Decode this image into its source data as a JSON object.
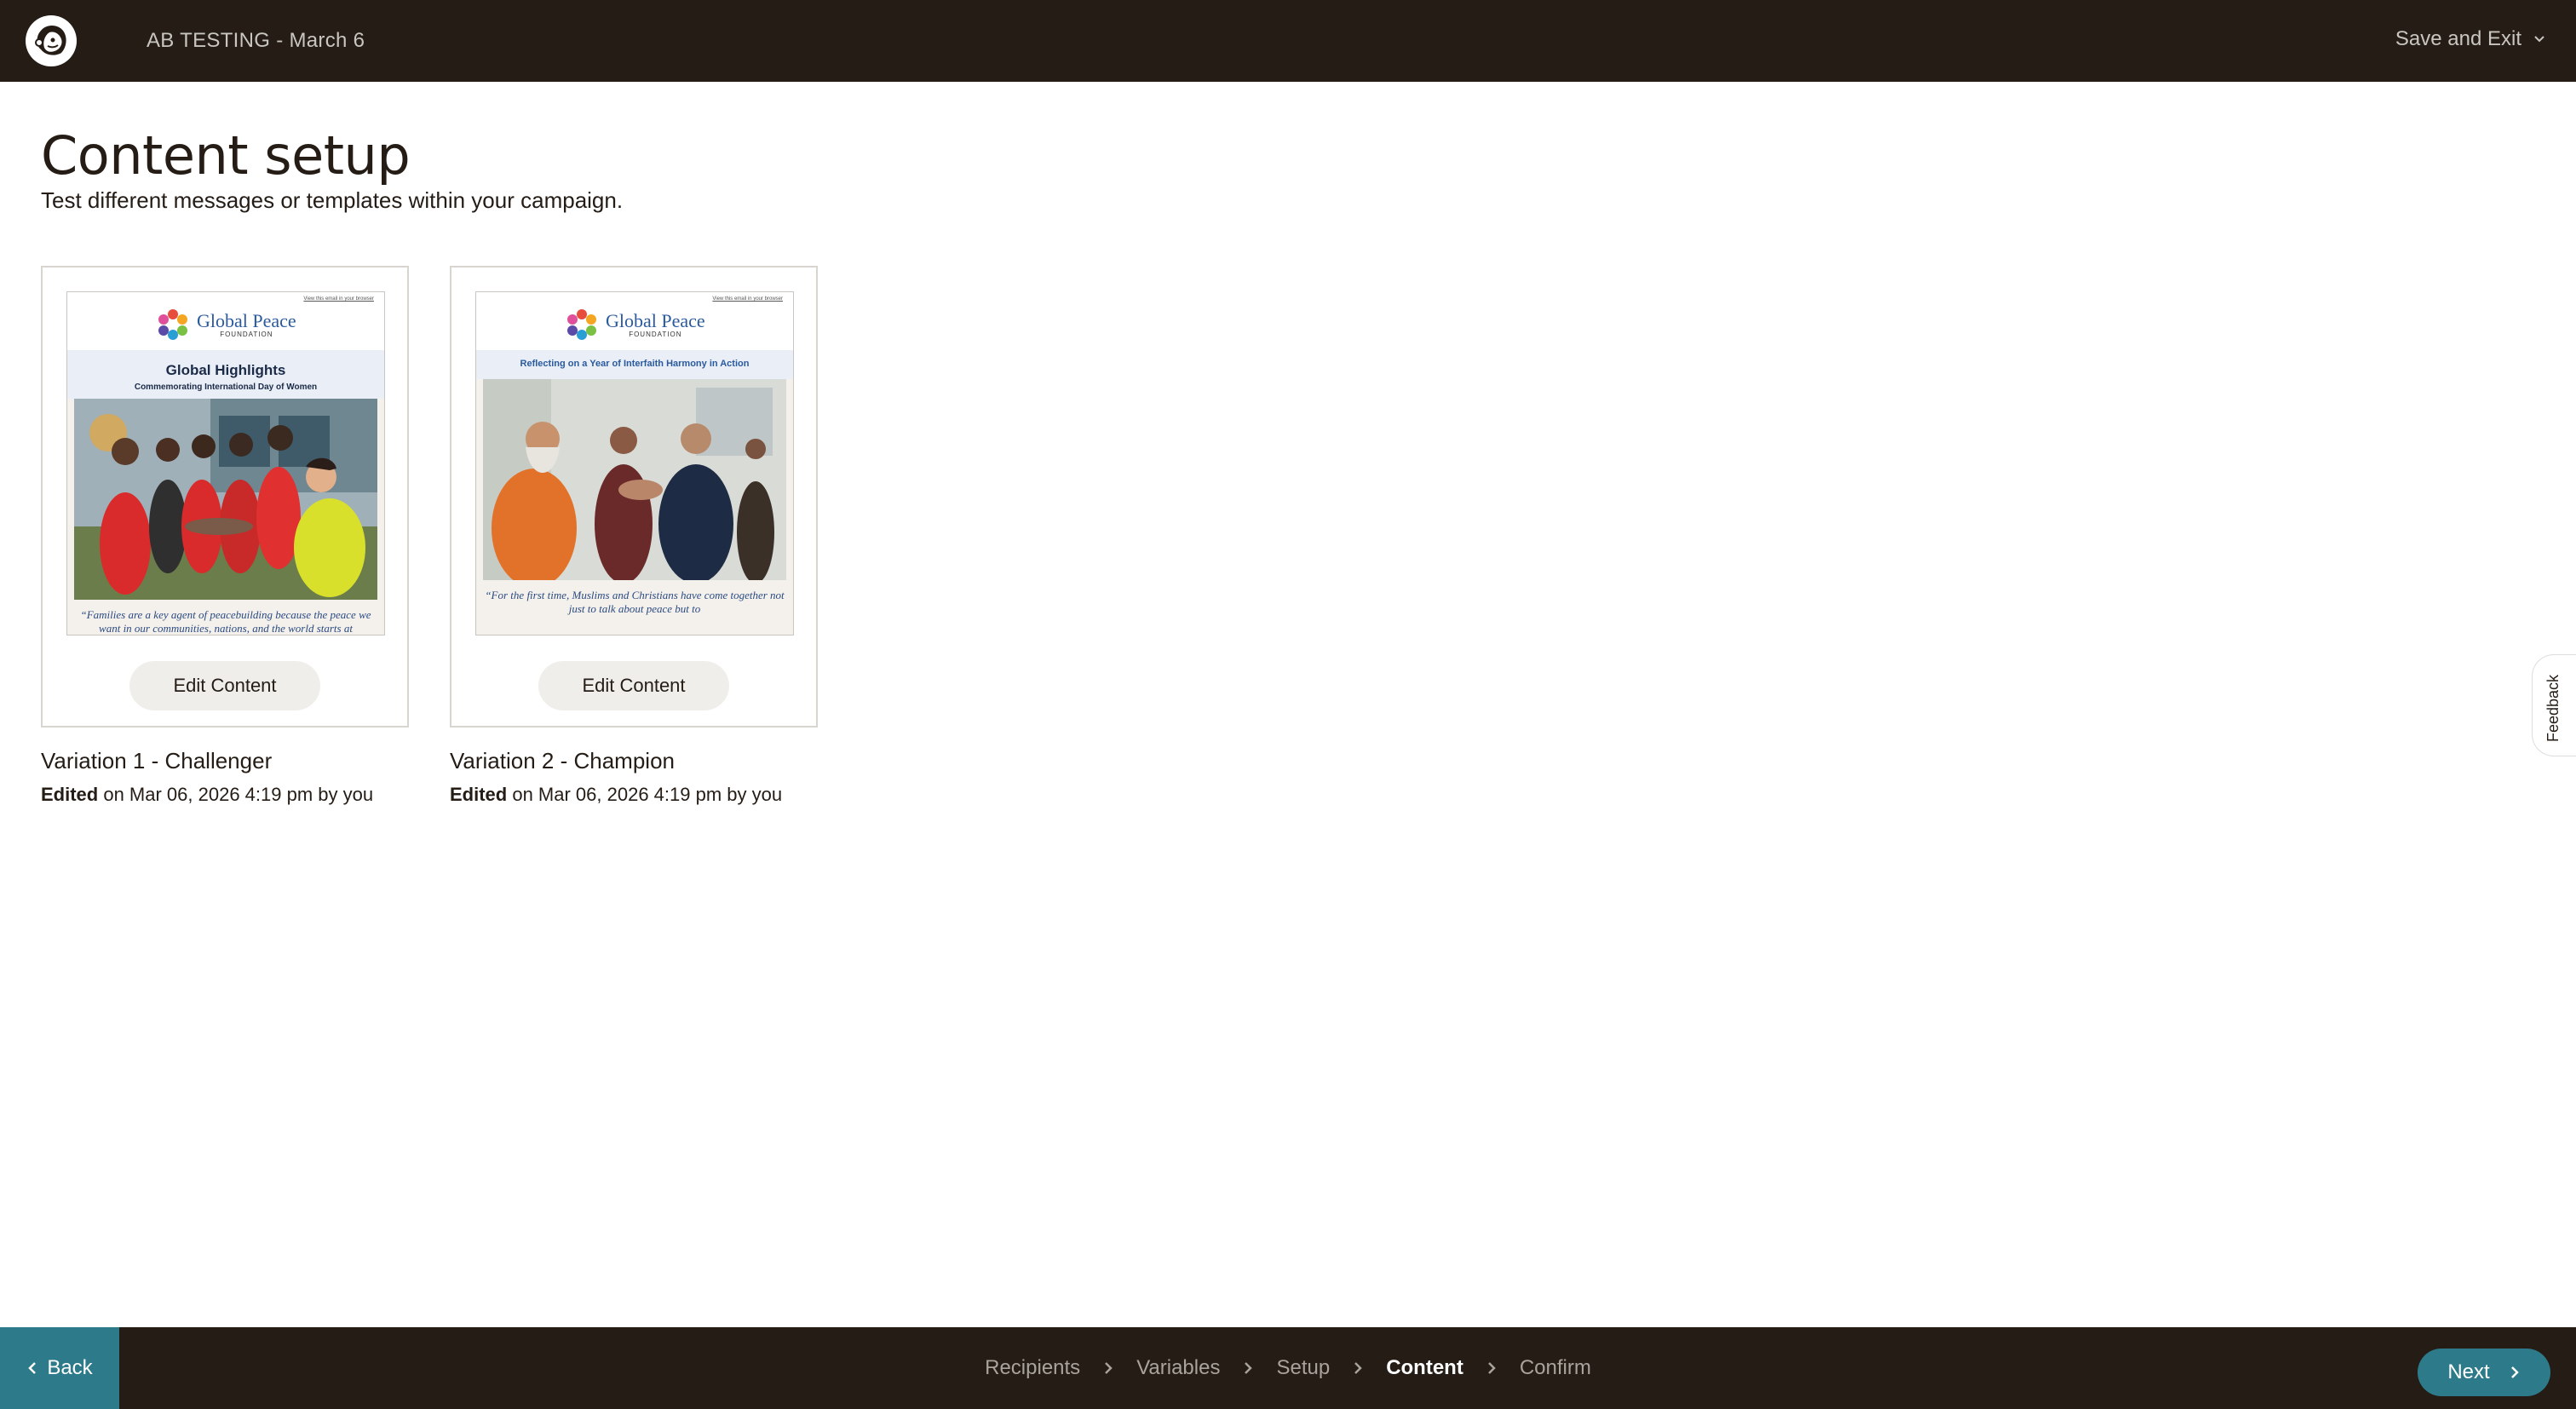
{
  "topbar": {
    "campaign_title": "AB TESTING - March 6",
    "save_exit_label": "Save and Exit"
  },
  "header": {
    "title": "Content setup",
    "subtitle": "Test different messages or templates within your campaign."
  },
  "variations": [
    {
      "name": "Variation 1 - Challenger",
      "edited_label": "Edited",
      "edited_rest": " on Mar 06, 2026 4:19 pm by you",
      "edit_button": "Edit Content",
      "preview": {
        "view_link": "View this email in your browser",
        "org_name": "Global Peace",
        "org_sub": "FOUNDATION",
        "headline": "Global Highlights",
        "subheadline": "Commemorating International Day of Women",
        "quote": "“Families are a key agent of peacebuilding because the peace we want in our communities, nations, and the world starts at"
      }
    },
    {
      "name": "Variation 2 - Champion",
      "edited_label": "Edited",
      "edited_rest": " on Mar 06, 2026 4:19 pm by you",
      "edit_button": "Edit Content",
      "preview": {
        "view_link": "View this email in your browser",
        "org_name": "Global Peace",
        "org_sub": "FOUNDATION",
        "headline": "Reflecting on a Year of Interfaith Harmony in Action",
        "quote": "“For the first time, Muslims and Christians have come together not just to talk about peace but to"
      }
    }
  ],
  "feedback_label": "Feedback",
  "bottombar": {
    "back_label": "Back",
    "next_label": "Next",
    "steps": [
      "Recipients",
      "Variables",
      "Setup",
      "Content",
      "Confirm"
    ],
    "active_step": "Content"
  },
  "colors": {
    "bar_bg": "#241c15",
    "accent": "#2d7a8a",
    "button_bg": "#efeeea"
  }
}
